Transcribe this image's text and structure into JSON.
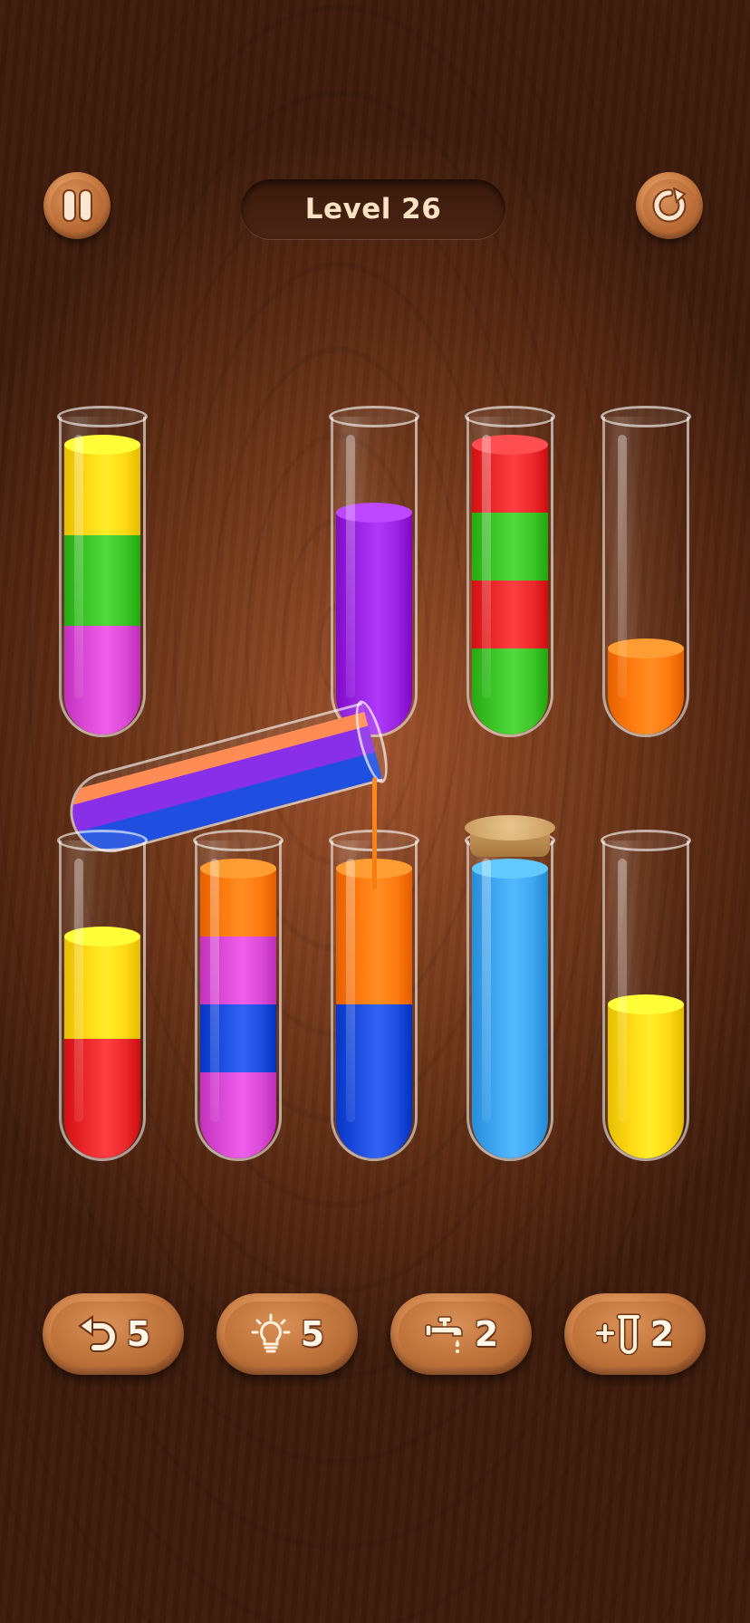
{
  "header": {
    "level_label": "Level 26"
  },
  "colors": {
    "yellow": "#ffd915",
    "green": "#3ec52a",
    "magenta": "#dc4ad8",
    "purple": "#9a25e4",
    "red": "#ec2a2d",
    "orange": "#ff7a0f",
    "blue": "#1f4fe0",
    "light_blue": "#3fa6f2",
    "salmon": "#ff8c55",
    "violet": "#8a2fe8"
  },
  "tubes_top_row": [
    {
      "name": "tube-1",
      "layers_bottom_to_top": [
        "magenta",
        "green",
        "yellow"
      ],
      "fill_units": 4
    },
    {
      "name": "tube-2",
      "layers_bottom_to_top": [
        "purple"
      ],
      "fill_units": 3
    },
    {
      "name": "tube-3",
      "layers_bottom_to_top": [
        "green",
        "red",
        "green",
        "red"
      ],
      "fill_units": 4
    },
    {
      "name": "tube-4",
      "layers_bottom_to_top": [
        "orange"
      ],
      "fill_units": 1
    }
  ],
  "tubes_bottom_row": [
    {
      "name": "tube-5",
      "layers_bottom_to_top": [
        "red",
        "yellow"
      ],
      "fill_units": 3
    },
    {
      "name": "tube-6",
      "layers_bottom_to_top": [
        "magenta",
        "blue",
        "magenta",
        "orange"
      ],
      "fill_units": 4
    },
    {
      "name": "tube-7",
      "layers_bottom_to_top": [
        "blue",
        "orange"
      ],
      "fill_units": 4
    },
    {
      "name": "tube-8",
      "layers_bottom_to_top": [
        "light_blue"
      ],
      "fill_units": 4,
      "corked": true
    },
    {
      "name": "tube-9",
      "layers_bottom_to_top": [
        "yellow"
      ],
      "fill_units": 2
    }
  ],
  "pouring_tube": {
    "layers_bottom_to_top": [
      "blue",
      "violet",
      "salmon"
    ]
  },
  "powerups": {
    "undo": {
      "count": "5",
      "icon": "undo-arrow-icon"
    },
    "hint": {
      "count": "5",
      "icon": "lightbulb-icon"
    },
    "tap": {
      "count": "2",
      "icon": "faucet-icon"
    },
    "add_tube": {
      "count": "2",
      "icon": "add-tube-icon"
    }
  },
  "icons": {
    "pause": "pause-icon",
    "restart": "restart-icon"
  }
}
